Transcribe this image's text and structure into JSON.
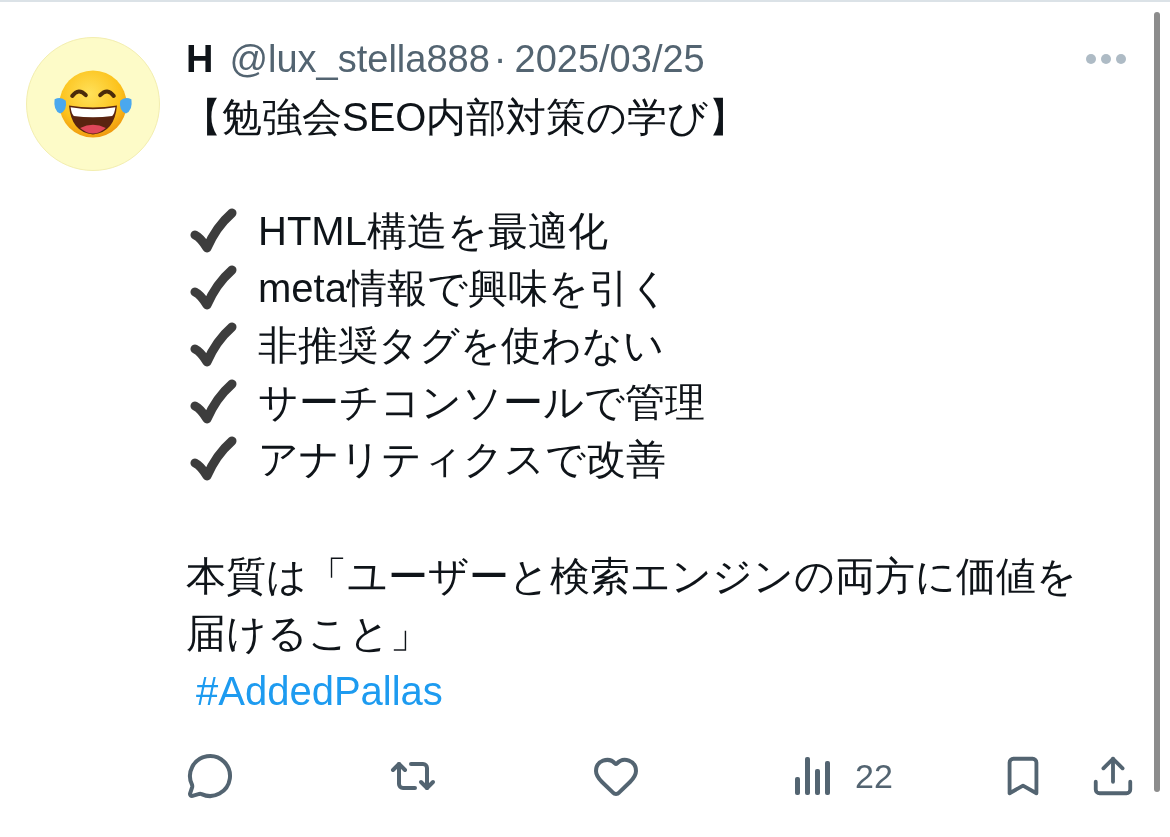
{
  "post": {
    "author": {
      "name": "H",
      "handle": "@lux_stella888",
      "separator": "·",
      "date": "2025/03/25"
    },
    "title": "【勉強会SEO内部対策の学び】",
    "checklist": [
      "HTML構造を最適化",
      "meta情報で興味を引く",
      "非推奨タグを使わない",
      "サーチコンソールで管理",
      "アナリティクスで改善"
    ],
    "summary": "本質は「ユーザーと検索エンジンの両方に価値を届けること」",
    "hashtag": "#AddedPallas",
    "actions": [
      {
        "kind": "reply"
      },
      {
        "kind": "repost"
      },
      {
        "kind": "like"
      },
      {
        "kind": "views",
        "count": "22"
      },
      {
        "kind": "bookmark"
      },
      {
        "kind": "share"
      }
    ]
  }
}
